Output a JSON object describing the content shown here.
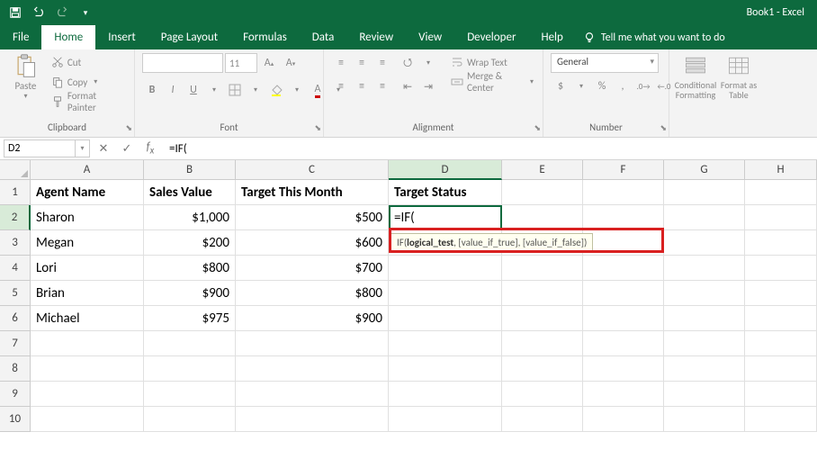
{
  "app": {
    "title": "Book1 - Excel"
  },
  "tabs": {
    "file": "File",
    "home": "Home",
    "insert": "Insert",
    "pagelayout": "Page Layout",
    "formulas": "Formulas",
    "data": "Data",
    "review": "Review",
    "view": "View",
    "developer": "Developer",
    "help": "Help",
    "tellme": "Tell me what you want to do"
  },
  "ribbon": {
    "clipboard": {
      "label": "Clipboard",
      "paste": "Paste",
      "cut": "Cut",
      "copy": "Copy",
      "painter": "Format Painter"
    },
    "font": {
      "label": "Font",
      "name": "",
      "size": "11"
    },
    "alignment": {
      "label": "Alignment",
      "wrap": "Wrap Text",
      "merge": "Merge & Center"
    },
    "number": {
      "label": "Number",
      "format": "General"
    },
    "styles": {
      "conditional": "Conditional Formatting",
      "formatas": "Format as Table"
    }
  },
  "namebox": "D2",
  "formula": "=IF(",
  "tooltip": {
    "fn": "IF(",
    "arg1": "logical_test",
    "rest": ", [value_if_true], [value_if_false])"
  },
  "columns": [
    "A",
    "B",
    "C",
    "D",
    "E",
    "F",
    "G",
    "H"
  ],
  "rows": [
    "1",
    "2",
    "3",
    "4",
    "5",
    "6",
    "7",
    "8",
    "9",
    "10"
  ],
  "headers": {
    "A": "Agent Name",
    "B": "Sales Value",
    "C": "Target This Month",
    "D": "Target Status"
  },
  "data": [
    {
      "A": "Sharon",
      "B": "$1,000",
      "C": "$500",
      "D": "=IF("
    },
    {
      "A": "Megan",
      "B": "$200",
      "C": "$600"
    },
    {
      "A": "Lori",
      "B": "$800",
      "C": "$700"
    },
    {
      "A": "Brian",
      "B": "$900",
      "C": "$800"
    },
    {
      "A": "Michael",
      "B": "$975",
      "C": "$900"
    }
  ],
  "chart_data": {
    "type": "table",
    "columns": [
      "Agent Name",
      "Sales Value",
      "Target This Month",
      "Target Status"
    ],
    "rows": [
      [
        "Sharon",
        1000,
        500,
        null
      ],
      [
        "Megan",
        200,
        600,
        null
      ],
      [
        "Lori",
        800,
        700,
        null
      ],
      [
        "Brian",
        900,
        800,
        null
      ],
      [
        "Michael",
        975,
        900,
        null
      ]
    ],
    "active_cell": "D2",
    "formula_in_progress": "=IF("
  }
}
